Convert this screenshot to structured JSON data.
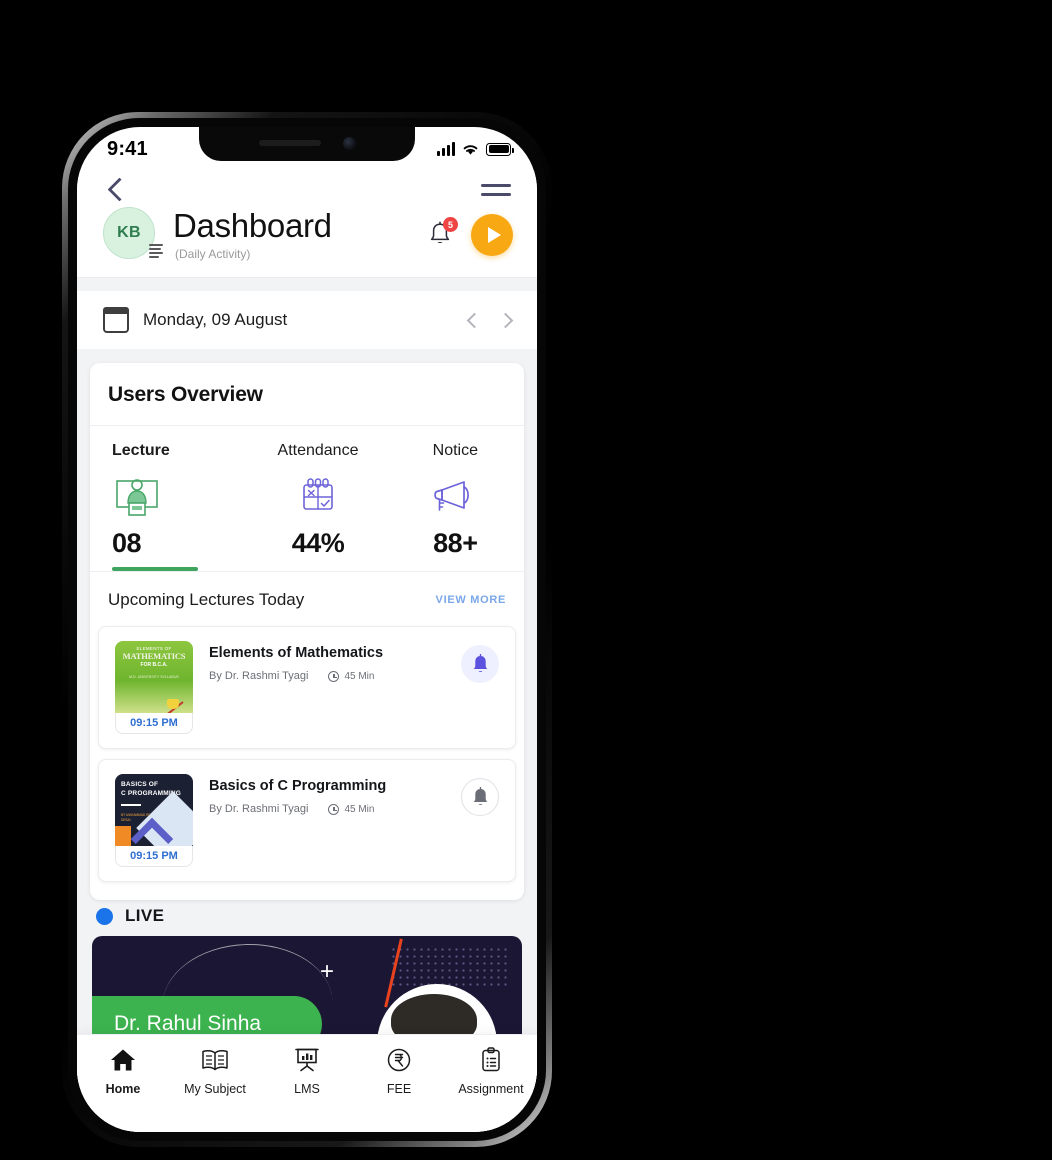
{
  "status_bar": {
    "time": "9:41",
    "signal_icon": "signal-bars-icon",
    "wifi_icon": "wifi-icon",
    "battery_icon": "battery-icon"
  },
  "topbar": {
    "back_icon": "chevron-left-icon",
    "menu_icon": "hamburger-menu-icon"
  },
  "header": {
    "avatar_initials": "KB",
    "title": "Dashboard",
    "subtitle": "(Daily Activity)",
    "notification_badge": "5",
    "bell_icon": "bell-icon",
    "play_icon": "play-icon"
  },
  "date_bar": {
    "calendar_icon": "calendar-icon",
    "date": "Monday, 09 August",
    "prev_icon": "chevron-left-icon",
    "next_icon": "chevron-right-icon"
  },
  "overview": {
    "title": "Users Overview",
    "stats": [
      {
        "label": "Lecture",
        "value": "08",
        "icon": "lecture-podium-icon",
        "color": "#3fa45e",
        "active": true
      },
      {
        "label": "Attendance",
        "value": "44%",
        "icon": "attendance-grid-icon",
        "color": "#6c63d8",
        "active": false
      },
      {
        "label": "Notice",
        "value": "88+",
        "icon": "megaphone-icon",
        "color": "#6c63d8",
        "active": false
      }
    ]
  },
  "lectures_section": {
    "title": "Upcoming Lectures Today",
    "view_more": "VIEW MORE",
    "items": [
      {
        "title": "Elements of Mathematics",
        "by": "By Dr. Rashmi Tyagi",
        "duration": "45 Min",
        "time": "09:15 PM",
        "bell_icon": "bell-filled-icon",
        "cover_line1": "ELEMENTS OF",
        "cover_line2": "MATHEMATICS",
        "cover_line3": "FOR B.C.A.",
        "cover_line4": "M.D. UNIVERSITY\nSYLLABUS"
      },
      {
        "title": "Basics of C Programming",
        "by": "By Dr. Rashmi Tyagi",
        "duration": "45 Min",
        "time": "09:15 PM",
        "bell_icon": "bell-outline-icon",
        "cover_line1": "BASICS OF",
        "cover_line2": "C PROGRAMMING",
        "cover_line4": "BY\nMUHAMMAD REHAN\nAND\nFASTR PRATIK DESAI"
      }
    ]
  },
  "live_section": {
    "label": "LIVE",
    "presenter": "Dr. Rahul Sinha"
  },
  "bottom_nav": {
    "items": [
      {
        "label": "Home",
        "icon": "home-icon",
        "active": true
      },
      {
        "label": "My Subject",
        "icon": "book-open-icon",
        "active": false
      },
      {
        "label": "LMS",
        "icon": "presentation-chart-icon",
        "active": false
      },
      {
        "label": "FEE",
        "icon": "rupee-circle-icon",
        "active": false
      },
      {
        "label": "Assignment",
        "icon": "clipboard-list-icon",
        "active": false
      }
    ]
  }
}
